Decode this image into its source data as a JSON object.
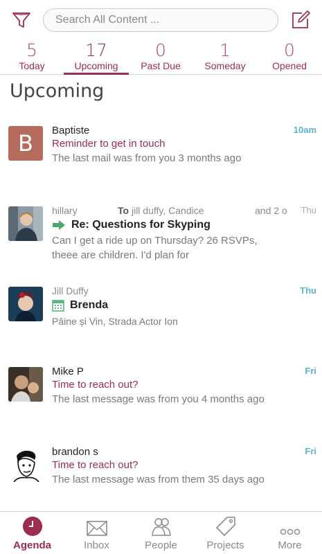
{
  "search": {
    "placeholder": "Search All Content ..."
  },
  "tabs": [
    {
      "count": "5",
      "label": "Today"
    },
    {
      "count": "17",
      "label": "Upcoming"
    },
    {
      "count": "0",
      "label": "Past Due"
    },
    {
      "count": "1",
      "label": "Someday"
    },
    {
      "count": "0",
      "label": "Opened"
    }
  ],
  "section_title": "Upcoming",
  "items": [
    {
      "avatar_letter": "B",
      "sender": "Baptiste",
      "time": "10am",
      "subject": "Reminder to get in touch",
      "snippet": "The last mail was from you 3 months ago"
    },
    {
      "sender": "hillary",
      "to_label": "To",
      "to": "jill duffy, Candice",
      "more": "and 2 o",
      "time": "Thu",
      "subject": "Re: Questions for Skyping",
      "snippet": "Can I get a ride up on Thursday? 26 RSVPs, theee are children. I'd plan for"
    },
    {
      "sender": "Jill Duffy",
      "time": "Thu",
      "subject": "Brenda",
      "snippet": "Pâine și Vin, Strada Actor Ion"
    },
    {
      "sender": "Mike P",
      "time": "Fri",
      "subject": "Time to reach out?",
      "snippet": "The last message was from you 4 months ago"
    },
    {
      "sender": "brandon s",
      "time": "Fri",
      "subject": "Time to reach out?",
      "snippet": "The last message was from them 35 days ago"
    }
  ],
  "bottom_nav": [
    {
      "label": "Agenda"
    },
    {
      "label": "Inbox"
    },
    {
      "label": "People"
    },
    {
      "label": "Projects"
    },
    {
      "label": "More"
    }
  ],
  "colors": {
    "accent": "#9b2d4f",
    "time_blue": "#5ab2cf",
    "avatar_b": "#b56c5c",
    "calendar_green": "#5cb87a"
  }
}
